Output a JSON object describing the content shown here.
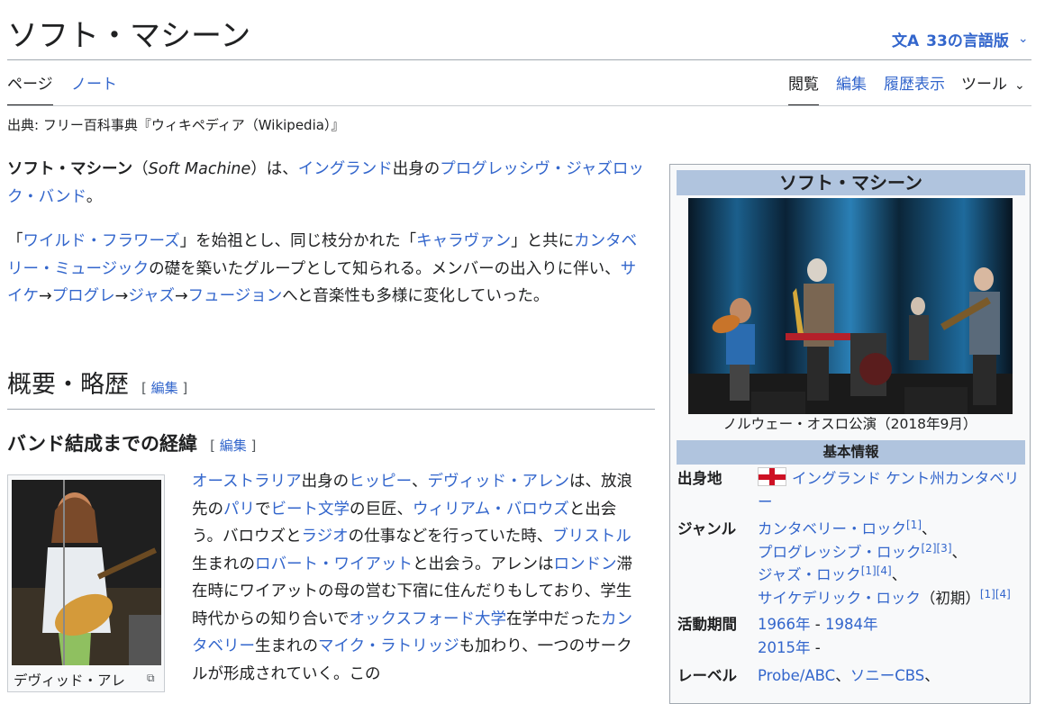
{
  "header": {
    "title": "ソフト・マシーン",
    "lang_icon": "文A",
    "lang_label": "33の言語版",
    "chevron": "⌄"
  },
  "tabs": {
    "page": "ページ",
    "talk": "ノート",
    "read": "閲覧",
    "edit": "編集",
    "history": "履歴表示",
    "tools": "ツール"
  },
  "source": "出典: フリー百科事典『ウィキペディア（Wikipedia）』",
  "intro": {
    "p1": {
      "bold": "ソフト・マシーン",
      "open": "（",
      "italic": "Soft Machine",
      "close": "）は、",
      "l1": "イングランド",
      "t1": "出身の",
      "l2": "プログレッシヴ・ジャズロック・バンド",
      "t2": "。"
    },
    "p2": {
      "t0": "「",
      "l1": "ワイルド・フラワーズ",
      "t1": "」を始祖とし、同じ枝分かれた「",
      "l2": "キャラヴァン",
      "t2": "」と共に",
      "l3": "カンタベリー・ミュージック",
      "t3": "の礎を築いたグループとして知られる。メンバーの出入りに伴い、",
      "l4": "サイケ",
      "a1": "→",
      "l5": "プログレ",
      "a2": "→",
      "l6": "ジャズ",
      "a3": "→",
      "l7": "フュージョン",
      "t4": "へと音楽性も多様に変化していった。"
    }
  },
  "sections": {
    "h2": "概要・略歴",
    "h3": "バンド結成までの経緯",
    "edit_open": "[ ",
    "edit": "編集",
    "edit_close": " ]"
  },
  "thumb": {
    "caption": "デヴィッド・アレ",
    "magnify": "⧉"
  },
  "p3": {
    "l1": "オーストラリア",
    "t1": "出身の",
    "l2": "ヒッピー",
    "t2": "、",
    "l3": "デヴィッド・アレン",
    "t3": "は、放浪先の",
    "l4": "パリ",
    "t4": "で",
    "l5": "ビート文学",
    "t5": "の巨匠、",
    "l6": "ウィリアム・バロウズ",
    "t6": "と出会う。バロウズと",
    "l7": "ラジオ",
    "t7": "の仕事などを行っていた時、",
    "l8": "ブリストル",
    "t8": "生まれの",
    "l9": "ロバート・ワイアット",
    "t9": "と出会う。アレンは",
    "l10": "ロンドン",
    "t10": "滞在時にワイアットの母の営む下宿に住んだりもしており、学生時代からの知り合いで",
    "l11": "オックスフォード大学",
    "t11": "在学中だった",
    "l12": "カンタベリー",
    "t12": "生まれの",
    "l13": "マイク・ラトリッジ",
    "t13": "も加わり、一つのサークルが形成されていく。この"
  },
  "infobox": {
    "title": "ソフト・マシーン",
    "caption": "ノルウェー・オスロ公演（2018年9月）",
    "subheader": "基本情報",
    "origin": {
      "label": "出身地",
      "l1": "イングランド",
      "sp": " ",
      "l2": "ケント州",
      "l3": "カンタベリー"
    },
    "genre": {
      "label": "ジャンル",
      "g1": "カンタベリー・ロック",
      "r1": "[1]",
      "c1": "、",
      "g2": "プログレッシブ・ロック",
      "r2": "[2]",
      "r3": "[3]",
      "c2": "、",
      "g3": "ジャズ・ロック",
      "r4": "[1]",
      "r5": "[4]",
      "c3": "、",
      "g4": "サイケデリック・ロック",
      "note": "（初期）",
      "r6": "[1]",
      "r7": "[4]"
    },
    "active": {
      "label": "活動期間",
      "y1": "1966年",
      "dash": " - ",
      "y2": "1984年",
      "y3": "2015年",
      "dash2": " -"
    },
    "label": {
      "label": "レーベル",
      "v1": "Probe/ABC",
      "c": "、",
      "v2": "ソニーCBS",
      "c2": "、"
    }
  },
  "colors": {
    "link": "#3366cc",
    "infobox_header": "#b0c4de",
    "text": "#202122"
  }
}
